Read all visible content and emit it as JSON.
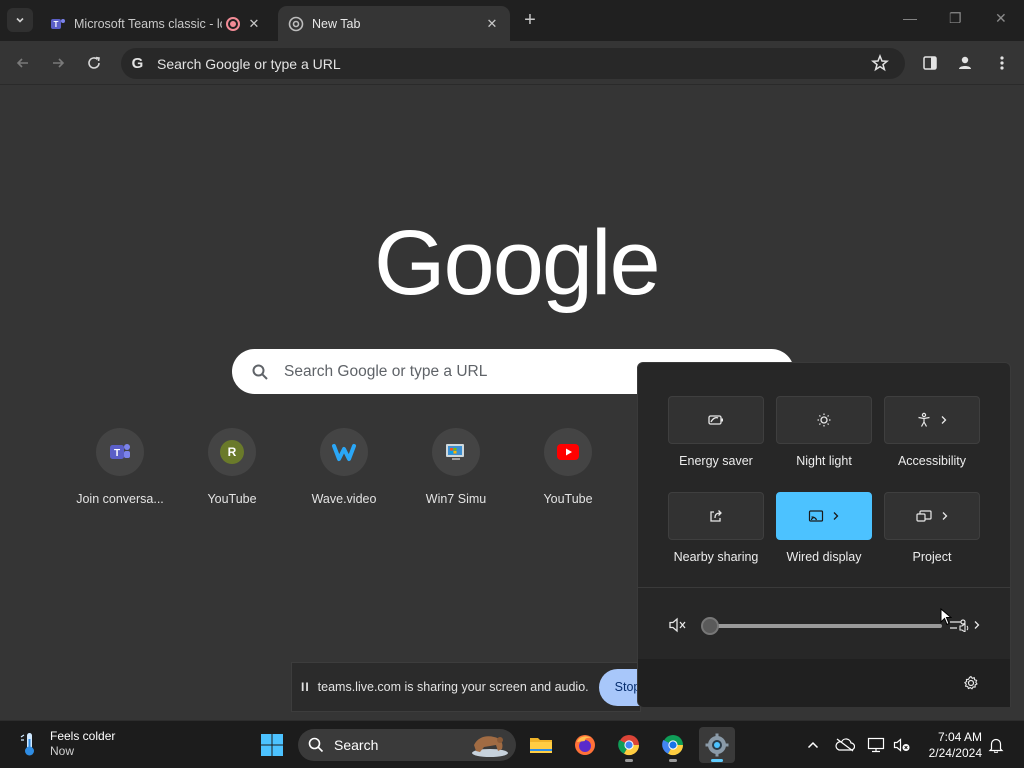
{
  "browser": {
    "tabs": [
      {
        "title": "Microsoft Teams classic - lo",
        "active": false,
        "recording": true
      },
      {
        "title": "New Tab",
        "active": true
      }
    ],
    "omnibox_text": "Search Google or type a URL"
  },
  "ntp": {
    "logo": "Google",
    "search_placeholder": "Search Google or type a URL",
    "shortcuts": [
      {
        "label": "Join conversa...",
        "icon": "teams-icon"
      },
      {
        "label": "YouTube",
        "icon": "letter-r-icon",
        "letter": "R"
      },
      {
        "label": "Wave.video",
        "icon": "wave-video-icon"
      },
      {
        "label": "Win7 Simu",
        "icon": "win7-simu-icon"
      },
      {
        "label": "YouTube",
        "icon": "youtube-icon"
      }
    ]
  },
  "share_bar": {
    "pause": "II",
    "message": "teams.live.com is sharing your screen and audio.",
    "stop_label": "Stop sh"
  },
  "quick_settings": {
    "tiles": [
      {
        "label": "Energy saver",
        "icon": "energy-saver-icon",
        "on": false,
        "chevron": false
      },
      {
        "label": "Night light",
        "icon": "night-light-icon",
        "on": false,
        "chevron": false
      },
      {
        "label": "Accessibility",
        "icon": "accessibility-icon",
        "on": false,
        "chevron": true
      },
      {
        "label": "Nearby sharing",
        "icon": "nearby-sharing-icon",
        "on": false,
        "chevron": false
      },
      {
        "label": "Wired display",
        "icon": "cast-icon",
        "on": true,
        "chevron": true
      },
      {
        "label": "Project",
        "icon": "project-icon",
        "on": false,
        "chevron": true
      }
    ],
    "volume_level": 0,
    "muted": true
  },
  "taskbar": {
    "weather_title": "Feels colder",
    "weather_sub": "Now",
    "search_label": "Search",
    "time": "7:04 AM",
    "date": "2/24/2024"
  },
  "colors": {
    "accent": "#4cc2ff",
    "page_bg": "#353535",
    "stop_button": "#a8c7fa",
    "recording": "#f28b96"
  }
}
